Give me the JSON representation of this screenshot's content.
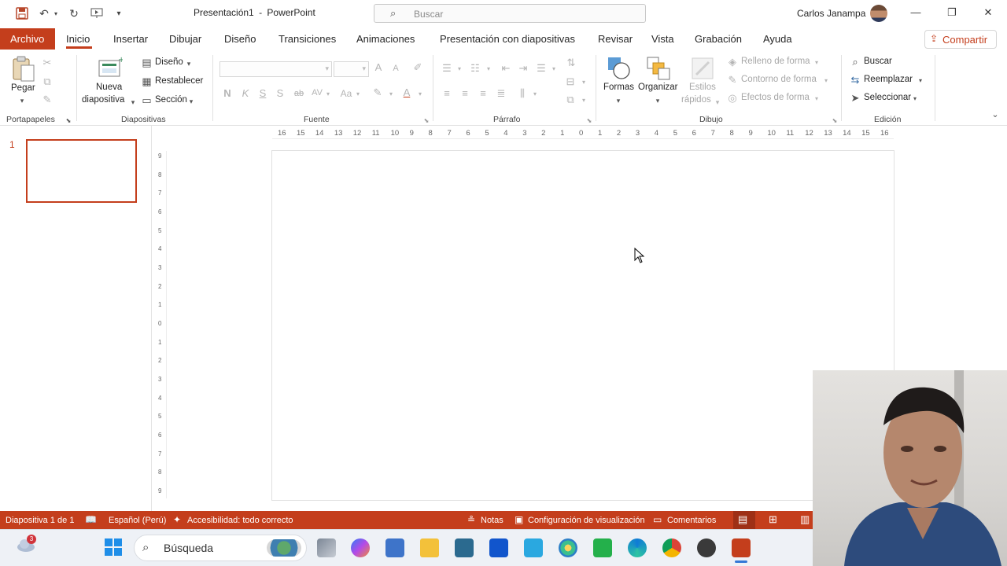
{
  "app": {
    "title": "Presentación1",
    "separator": "-",
    "app_name": "PowerPoint",
    "search_placeholder": "Buscar",
    "user_name": "Carlos Janampa"
  },
  "colors": {
    "accent": "#c43e1c",
    "statusbar": "#c43e1c",
    "taskbar": "#eef1f6"
  },
  "tabs": {
    "archivo": "Archivo",
    "items": [
      "Inicio",
      "Insertar",
      "Dibujar",
      "Diseño",
      "Transiciones",
      "Animaciones",
      "Presentación con diapositivas",
      "Revisar",
      "Vista",
      "Grabación",
      "Ayuda"
    ],
    "active": "Inicio",
    "share": "Compartir"
  },
  "ribbon": {
    "portapapeles": {
      "label": "Portapapeles",
      "paste": "Pegar"
    },
    "diapositivas": {
      "label": "Diapositivas",
      "new_slide_1": "Nueva",
      "new_slide_2": "diapositiva",
      "layout": "Diseño",
      "reset": "Restablecer",
      "section": "Sección"
    },
    "fuente": {
      "label": "Fuente",
      "bold": "N",
      "italic": "K",
      "underline": "S",
      "shadow": "S",
      "strike": "ab",
      "spacing": "AV",
      "case": "Aa",
      "grow": "A",
      "shrink": "A"
    },
    "parrafo": {
      "label": "Párrafo"
    },
    "dibujo": {
      "label": "Dibujo",
      "shapes": "Formas",
      "arrange": "Organizar",
      "styles_1": "Estilos",
      "styles_2": "rápidos",
      "fill": "Relleno de forma",
      "outline": "Contorno de forma",
      "effects": "Efectos de forma"
    },
    "edicion": {
      "label": "Edición",
      "find": "Buscar",
      "replace": "Reemplazar",
      "select": "Seleccionar"
    }
  },
  "slides_pane": {
    "slide_number": "1"
  },
  "rulers": {
    "horizontal": [
      "16",
      "15",
      "14",
      "13",
      "12",
      "11",
      "10",
      "9",
      "8",
      "7",
      "6",
      "5",
      "4",
      "3",
      "2",
      "1",
      "0",
      "1",
      "2",
      "3",
      "4",
      "5",
      "6",
      "7",
      "8",
      "9",
      "10",
      "11",
      "12",
      "13",
      "14",
      "15",
      "16"
    ],
    "vertical": [
      "9",
      "8",
      "7",
      "6",
      "5",
      "4",
      "3",
      "2",
      "1",
      "0",
      "1",
      "2",
      "3",
      "4",
      "5",
      "6",
      "7",
      "8",
      "9"
    ]
  },
  "statusbar": {
    "slide_info": "Diapositiva 1 de 1",
    "language": "Español (Perú)",
    "accessibility": "Accesibilidad: todo correcto",
    "notes": "Notas",
    "display_settings": "Configuración de visualización",
    "comments": "Comentarios"
  },
  "taskbar": {
    "search_label": "Búsqueda",
    "weather_badge": "3"
  }
}
